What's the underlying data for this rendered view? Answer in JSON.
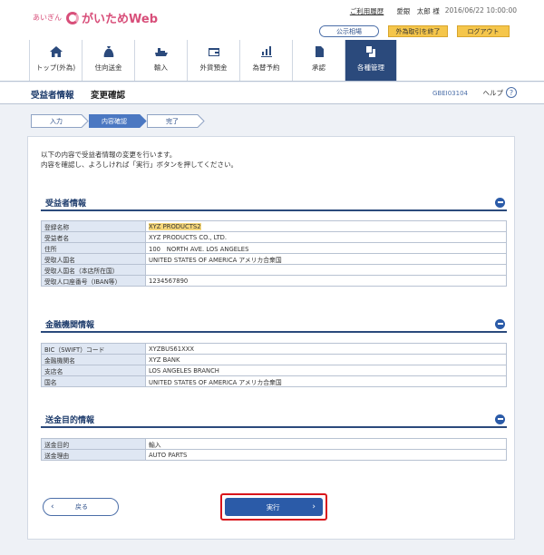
{
  "header": {
    "bank_small": "あいぎん",
    "app_name": "がいためWeb",
    "usage_history": "ご利用履歴",
    "user_name": "愛銀　太郎 様",
    "datetime": "2016/06/22 10:00:00",
    "rate_button": "公示相場",
    "end_fx_button": "外為取引を終了",
    "logout_button": "ログアウト"
  },
  "nav": [
    {
      "label": "トップ(外為)",
      "icon": "home-icon"
    },
    {
      "label": "住向送金",
      "icon": "money-bag-icon"
    },
    {
      "label": "輸入",
      "icon": "ship-icon"
    },
    {
      "label": "外貨預金",
      "icon": "wallet-icon"
    },
    {
      "label": "為替予約",
      "icon": "exchange-chart-icon"
    },
    {
      "label": "承認",
      "icon": "approval-icon"
    },
    {
      "label": "各種管理",
      "icon": "management-icon"
    }
  ],
  "page": {
    "category": "受益者情報",
    "title": "変更確認",
    "code": "GBEI03104",
    "help": "ヘルプ"
  },
  "steps": [
    "入力",
    "内容確認",
    "完了"
  ],
  "intro": [
    "以下の内容で受益者情報の変更を行います。",
    "内容を確認し、よろしければ「実行」ボタンを押してください。"
  ],
  "sections": {
    "beneficiary": {
      "title": "受益者情報",
      "rows": [
        {
          "label": "登録名称",
          "value": "XYZ PRODUCTS2"
        },
        {
          "label": "受益者名",
          "value": "XYZ PRODUCTS CO., LTD."
        },
        {
          "label": "住所",
          "value": "100　NORTH AVE. LOS ANGELES"
        },
        {
          "label": "受取人国名",
          "value": "UNITED STATES OF AMERICA アメリカ合衆国"
        },
        {
          "label": "受取人国名（本店所在国）",
          "value": ""
        },
        {
          "label": "受取人口座番号（IBAN等）",
          "value": "1234567890"
        }
      ]
    },
    "bank": {
      "title": "金融機関情報",
      "rows": [
        {
          "label": "BIC（SWIFT）コード",
          "value": "XYZBUS61XXX"
        },
        {
          "label": "金融機関名",
          "value": "XYZ BANK"
        },
        {
          "label": "支店名",
          "value": "LOS ANGELES BRANCH"
        },
        {
          "label": "国名",
          "value": "UNITED STATES OF AMERICA アメリカ合衆国"
        }
      ]
    },
    "purpose": {
      "title": "送金目的情報",
      "rows": [
        {
          "label": "送金目的",
          "value": "輸入"
        },
        {
          "label": "送金理由",
          "value": "AUTO PARTS"
        }
      ]
    }
  },
  "actions": {
    "back": "戻る",
    "execute": "実行"
  },
  "colors": {
    "brand": "#d84f7a",
    "navy": "#2b4a7c",
    "accent_blue": "#2b5ba8",
    "highlight": "#f6d77a",
    "execute_outline": "#d9151b"
  }
}
